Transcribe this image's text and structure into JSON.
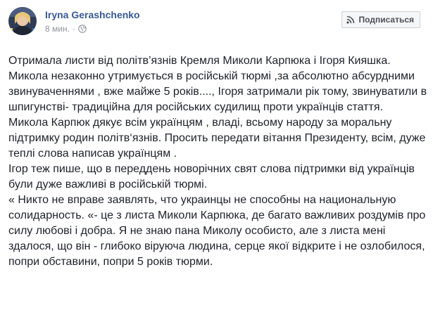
{
  "post": {
    "author": "Iryna Gerashchenko",
    "time": "8 мин.",
    "separator": "·",
    "privacy_icon": "globe-icon",
    "avatar_icon": "profile-photo",
    "subscribe_icon": "rss-icon",
    "subscribe_label": "Подписаться",
    "paragraphs": [
      "Отримала листи від політв’язнів Кремля Миколи Карпюка і Ігоря Кияшка. Микола незаконно утримується в російській тюрмі ,за абсолютно абсурдними звинуваченнями , вже майже 5 років...., Ігоря затримали рік тому, звинуватили в шпигунстві- традиційна для російських судилищ проти українців стаття.",
      "Микола Карпюк дякує всім українцям , владі, всьому народу за моральну підтримку родин політв‘язнів. Просить передати вітання Президенту, всім, дуже теплі слова написав українцям .",
      "Ігор теж пише, що в переддень новорічних свят слова підтримки від українців були дуже важливі в російській тюрмі.",
      "« Никто не вправе заявлять, что украинцы не способны на национальную солидарность. «- це з листа Миколи Карпюка, де багато важливих роздумів про силу любові і добра. Я не знаю пана Миколу особисто, але з листа мені здалося, що він - глибоко віруюча людина, серце якої відкрите і не озлобилося, попри обставини, попри 5 років тюрми."
    ]
  },
  "colors": {
    "author_link": "#385898",
    "meta_text": "#90949c",
    "body_text": "#1d2129",
    "button_bg": "#f5f6f7",
    "button_border": "#ccd0d5"
  }
}
